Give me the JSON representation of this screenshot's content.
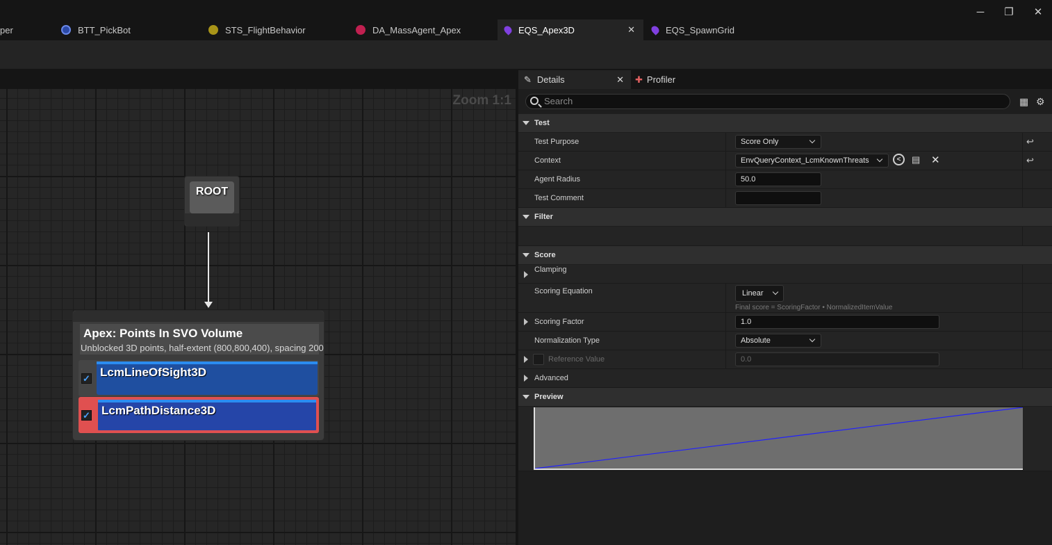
{
  "tabs": [
    {
      "label": "per",
      "icon": "cut-off-tab-icon",
      "color": "#ffffff"
    },
    {
      "label": "BTT_PickBot",
      "icon": "behavior-tree-task-icon",
      "color": "#4060c8"
    },
    {
      "label": "STS_FlightBehavior",
      "icon": "state-tree-icon",
      "color": "#c8b420"
    },
    {
      "label": "DA_MassAgent_Apex",
      "icon": "data-asset-icon",
      "color": "#c02050"
    },
    {
      "label": "EQS_Apex3D",
      "icon": "eqs-icon",
      "color": "#8040e0"
    },
    {
      "label": "EQS_SpawnGrid",
      "icon": "eqs-icon",
      "color": "#8040e0"
    }
  ],
  "window": {
    "minimize": "─",
    "maximize": "❐",
    "close": "✕"
  },
  "graph": {
    "zoom": "Zoom 1:1",
    "root_label": "ROOT",
    "generator": {
      "title": "Apex: Points In SVO Volume",
      "subtitle": "Unblocked 3D points, half-extent (800,800,400), spacing 200",
      "tests": [
        {
          "label": "LcmLineOfSight3D",
          "checked": true
        },
        {
          "label": "LcmPathDistance3D",
          "checked": true,
          "selected": true
        }
      ]
    }
  },
  "panel_tabs": {
    "details": "Details",
    "profiler": "Profiler"
  },
  "details": {
    "search_placeholder": "Search",
    "test_category": "Test",
    "test_purpose_label": "Test Purpose",
    "test_purpose_value": "Score Only",
    "context_label": "Context",
    "context_value": "EnvQueryContext_LcmKnownThreats",
    "agent_radius_label": "Agent Radius",
    "agent_radius_value": "50.0",
    "test_comment_label": "Test Comment",
    "test_comment_value": "",
    "filter_category": "Filter",
    "score_category": "Score",
    "clamping_label": "Clamping",
    "scoring_equation_label": "Scoring Equation",
    "scoring_equation_value": "Linear",
    "scoring_equation_hint": "Final score = ScoringFactor • NormalizedItemValue",
    "scoring_factor_label": "Scoring Factor",
    "scoring_factor_value": "1.0",
    "normalization_label": "Normalization Type",
    "normalization_value": "Absolute",
    "reference_label": "Reference Value",
    "reference_value": "0.0",
    "advanced_category": "Advanced",
    "preview_category": "Preview"
  },
  "preview_curve": {
    "type": "line",
    "x": [
      0,
      1
    ],
    "y": [
      0,
      1
    ],
    "color": "#2020ff"
  }
}
